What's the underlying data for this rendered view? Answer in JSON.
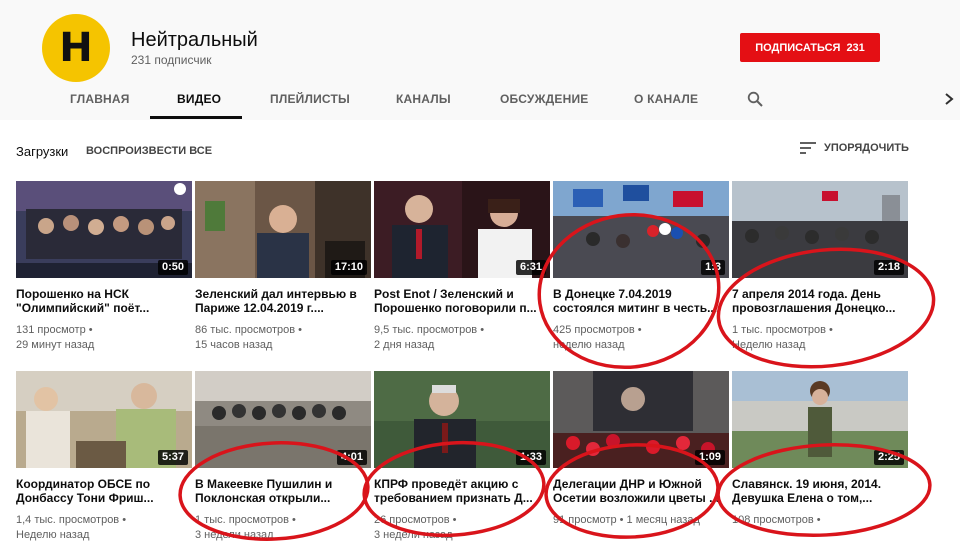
{
  "channel": {
    "avatar_letter": "H",
    "name": "Нейтральный",
    "subscribers": "231 подписчик",
    "subscribe_label": "ПОДПИСАТЬСЯ",
    "subscribe_count": "231"
  },
  "tabs": [
    {
      "label": "ГЛАВНАЯ",
      "active": false
    },
    {
      "label": "ВИДЕО",
      "active": true
    },
    {
      "label": "ПЛЕЙЛИСТЫ",
      "active": false
    },
    {
      "label": "КАНАЛЫ",
      "active": false
    },
    {
      "label": "ОБСУЖДЕНИЕ",
      "active": false
    },
    {
      "label": "О КАНАЛЕ",
      "active": false
    }
  ],
  "icons": {
    "search": "search-icon",
    "next": "chevron-right-icon",
    "sort": "sort-icon"
  },
  "section": {
    "title": "Загрузки",
    "play_all": "ВОСПРОИЗВЕСТИ ВСЕ",
    "sort_label": "УПОРЯДОЧИТЬ"
  },
  "colors": {
    "subscribe": "#e40f14",
    "avatar": "#f5c400",
    "annotation": "#d9141b"
  },
  "videos": [
    {
      "title": "Порошенко на НСК \"Олимпийский\" поёт...",
      "views": "131 просмотр •",
      "age": "29 минут назад",
      "duration": "0:50"
    },
    {
      "title": "Зеленский дал интервью в Париже 12.04.2019 г....",
      "views": "86 тыс. просмотров •",
      "age": "15 часов назад",
      "duration": "17:10"
    },
    {
      "title": "Post Enot / Зеленский и Порошенко поговорили п...",
      "views": "9,5 тыс. просмотров •",
      "age": "2 дня назад",
      "duration": "6:31"
    },
    {
      "title": "В Донецке 7.04.2019 состоялся митинг в честь...",
      "views": "425 просмотров •",
      "age": "неделю назад",
      "duration": "1:3"
    },
    {
      "title": "7 апреля 2014 года. День провозглашения Донецко...",
      "views": "1 тыс. просмотров •",
      "age": "Неделю назад",
      "duration": "2:18"
    },
    {
      "title": "Координатор ОБСЕ по Донбассу Тони Фриш...",
      "views": "1,4 тыс. просмотров •",
      "age": "Неделю назад",
      "duration": "5:37"
    },
    {
      "title": "В Макеевке Пушилин и Поклонская открыли...",
      "views": "1 тыс. просмотров •",
      "age": "3 недели назад",
      "duration": "4:01"
    },
    {
      "title": "КПРФ проведёт акцию с требованием признать Д...",
      "views": "26 просмотров •",
      "age": "3 недели назад",
      "duration": "1:33"
    },
    {
      "title": "Делегации ДНР и Южной Осетии возложили цветы ...",
      "views": "91 просмотр • 1 месяц назад",
      "age": "",
      "duration": "1:09"
    },
    {
      "title": "Славянск. 19 июня, 2014. Девушка Елена о том,...",
      "views": "108 просмотров •",
      "age": "",
      "duration": "2:25"
    }
  ]
}
